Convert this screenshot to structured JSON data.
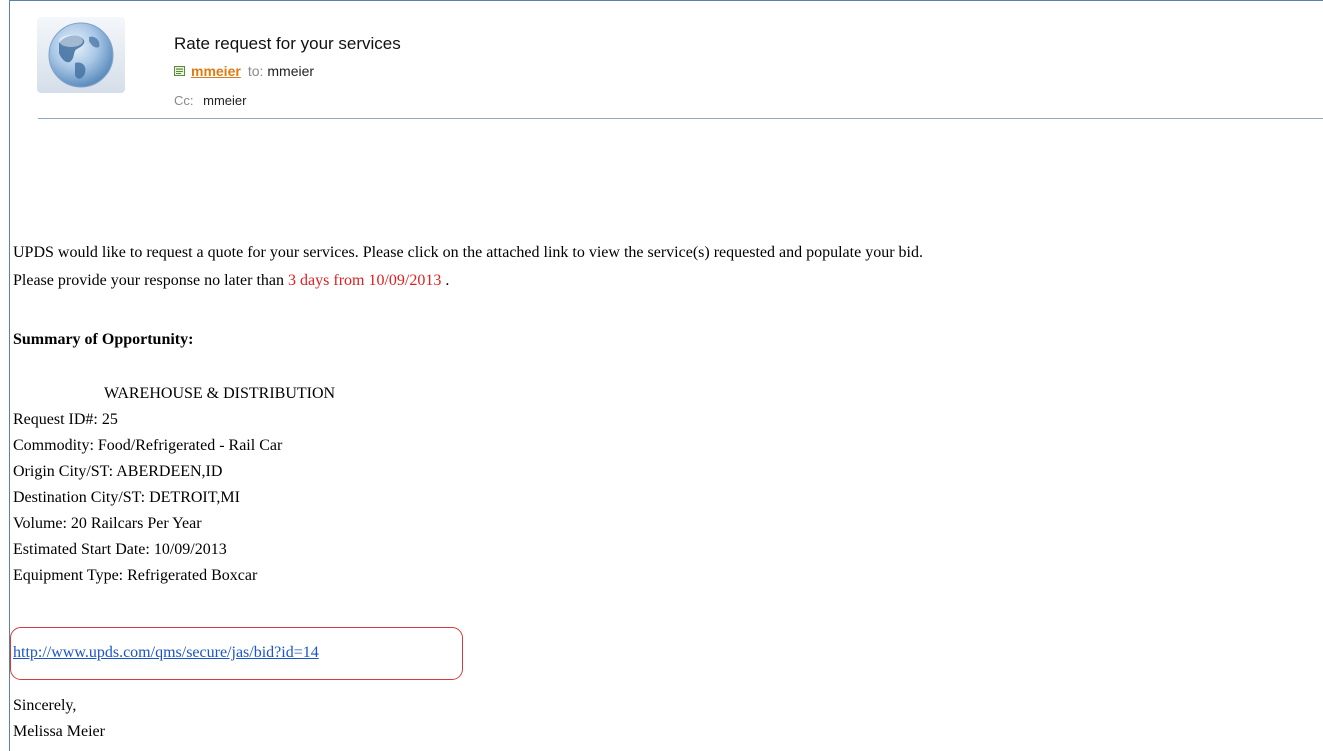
{
  "header": {
    "subject": "Rate request for your services",
    "from": "mmeier",
    "to_label": "to:",
    "to": "mmeier",
    "cc_label": "Cc:",
    "cc": "mmeier",
    "avatar_icon": "globe-avatar-icon",
    "contact_icon": "contact-card-icon",
    "sender_color": "#e07b12"
  },
  "body": {
    "intro": "UPDS would like to request a quote for your services. Please click on the attached link to view the service(s) requested and populate your bid.",
    "deadline_prefix": "Please provide your response no later than",
    "deadline_value": "3 days from 10/09/2013",
    "deadline_suffix": ".",
    "summary_heading": "Summary of Opportunity:",
    "details": {
      "category": "WAREHOUSE & DISTRIBUTION",
      "request_id": "Request ID#: 25",
      "commodity": "Commodity: Food/Refrigerated - Rail Car",
      "origin": "Origin City/ST: ABERDEEN,ID",
      "destination": "Destination City/ST: DETROIT,MI",
      "volume": "Volume: 20 Railcars Per Year",
      "start_date": "Estimated Start Date: 10/09/2013",
      "equipment": "Equipment Type: Refrigerated Boxcar"
    },
    "bid_link": "http://www.upds.com/qms/secure/jas/bid?id=14",
    "closing": "Sincerely,",
    "signature": "Melissa Meier",
    "highlight_color": "#e02020",
    "link_color": "#1a55c8"
  }
}
